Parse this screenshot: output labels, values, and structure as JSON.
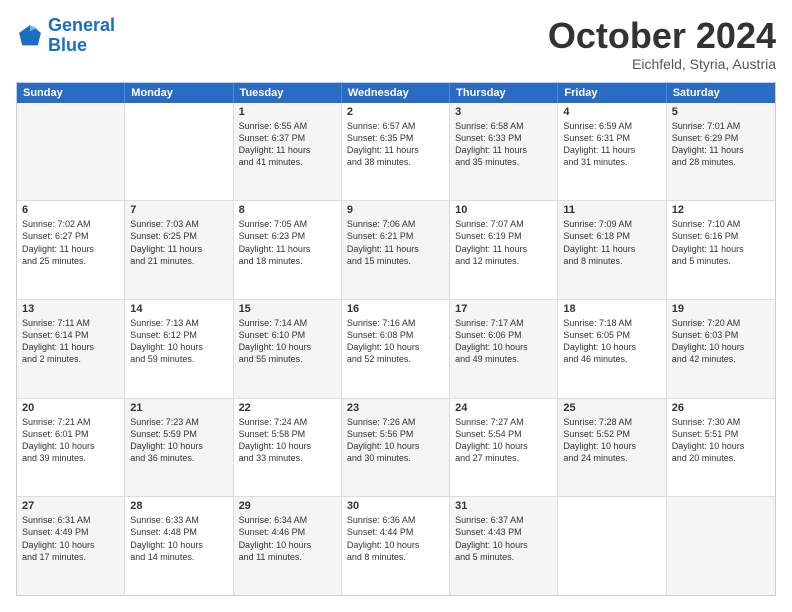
{
  "logo": {
    "line1": "General",
    "line2": "Blue"
  },
  "header": {
    "month": "October 2024",
    "location": "Eichfeld, Styria, Austria"
  },
  "weekdays": [
    "Sunday",
    "Monday",
    "Tuesday",
    "Wednesday",
    "Thursday",
    "Friday",
    "Saturday"
  ],
  "rows": [
    [
      {
        "day": "",
        "lines": [],
        "shaded": true
      },
      {
        "day": "",
        "lines": [],
        "shaded": false
      },
      {
        "day": "1",
        "lines": [
          "Sunrise: 6:55 AM",
          "Sunset: 6:37 PM",
          "Daylight: 11 hours",
          "and 41 minutes."
        ],
        "shaded": true
      },
      {
        "day": "2",
        "lines": [
          "Sunrise: 6:57 AM",
          "Sunset: 6:35 PM",
          "Daylight: 11 hours",
          "and 38 minutes."
        ],
        "shaded": false
      },
      {
        "day": "3",
        "lines": [
          "Sunrise: 6:58 AM",
          "Sunset: 6:33 PM",
          "Daylight: 11 hours",
          "and 35 minutes."
        ],
        "shaded": true
      },
      {
        "day": "4",
        "lines": [
          "Sunrise: 6:59 AM",
          "Sunset: 6:31 PM",
          "Daylight: 11 hours",
          "and 31 minutes."
        ],
        "shaded": false
      },
      {
        "day": "5",
        "lines": [
          "Sunrise: 7:01 AM",
          "Sunset: 6:29 PM",
          "Daylight: 11 hours",
          "and 28 minutes."
        ],
        "shaded": true
      }
    ],
    [
      {
        "day": "6",
        "lines": [
          "Sunrise: 7:02 AM",
          "Sunset: 6:27 PM",
          "Daylight: 11 hours",
          "and 25 minutes."
        ],
        "shaded": false
      },
      {
        "day": "7",
        "lines": [
          "Sunrise: 7:03 AM",
          "Sunset: 6:25 PM",
          "Daylight: 11 hours",
          "and 21 minutes."
        ],
        "shaded": true
      },
      {
        "day": "8",
        "lines": [
          "Sunrise: 7:05 AM",
          "Sunset: 6:23 PM",
          "Daylight: 11 hours",
          "and 18 minutes."
        ],
        "shaded": false
      },
      {
        "day": "9",
        "lines": [
          "Sunrise: 7:06 AM",
          "Sunset: 6:21 PM",
          "Daylight: 11 hours",
          "and 15 minutes."
        ],
        "shaded": true
      },
      {
        "day": "10",
        "lines": [
          "Sunrise: 7:07 AM",
          "Sunset: 6:19 PM",
          "Daylight: 11 hours",
          "and 12 minutes."
        ],
        "shaded": false
      },
      {
        "day": "11",
        "lines": [
          "Sunrise: 7:09 AM",
          "Sunset: 6:18 PM",
          "Daylight: 11 hours",
          "and 8 minutes."
        ],
        "shaded": true
      },
      {
        "day": "12",
        "lines": [
          "Sunrise: 7:10 AM",
          "Sunset: 6:16 PM",
          "Daylight: 11 hours",
          "and 5 minutes."
        ],
        "shaded": false
      }
    ],
    [
      {
        "day": "13",
        "lines": [
          "Sunrise: 7:11 AM",
          "Sunset: 6:14 PM",
          "Daylight: 11 hours",
          "and 2 minutes."
        ],
        "shaded": true
      },
      {
        "day": "14",
        "lines": [
          "Sunrise: 7:13 AM",
          "Sunset: 6:12 PM",
          "Daylight: 10 hours",
          "and 59 minutes."
        ],
        "shaded": false
      },
      {
        "day": "15",
        "lines": [
          "Sunrise: 7:14 AM",
          "Sunset: 6:10 PM",
          "Daylight: 10 hours",
          "and 55 minutes."
        ],
        "shaded": true
      },
      {
        "day": "16",
        "lines": [
          "Sunrise: 7:16 AM",
          "Sunset: 6:08 PM",
          "Daylight: 10 hours",
          "and 52 minutes."
        ],
        "shaded": false
      },
      {
        "day": "17",
        "lines": [
          "Sunrise: 7:17 AM",
          "Sunset: 6:06 PM",
          "Daylight: 10 hours",
          "and 49 minutes."
        ],
        "shaded": true
      },
      {
        "day": "18",
        "lines": [
          "Sunrise: 7:18 AM",
          "Sunset: 6:05 PM",
          "Daylight: 10 hours",
          "and 46 minutes."
        ],
        "shaded": false
      },
      {
        "day": "19",
        "lines": [
          "Sunrise: 7:20 AM",
          "Sunset: 6:03 PM",
          "Daylight: 10 hours",
          "and 42 minutes."
        ],
        "shaded": true
      }
    ],
    [
      {
        "day": "20",
        "lines": [
          "Sunrise: 7:21 AM",
          "Sunset: 6:01 PM",
          "Daylight: 10 hours",
          "and 39 minutes."
        ],
        "shaded": false
      },
      {
        "day": "21",
        "lines": [
          "Sunrise: 7:23 AM",
          "Sunset: 5:59 PM",
          "Daylight: 10 hours",
          "and 36 minutes."
        ],
        "shaded": true
      },
      {
        "day": "22",
        "lines": [
          "Sunrise: 7:24 AM",
          "Sunset: 5:58 PM",
          "Daylight: 10 hours",
          "and 33 minutes."
        ],
        "shaded": false
      },
      {
        "day": "23",
        "lines": [
          "Sunrise: 7:26 AM",
          "Sunset: 5:56 PM",
          "Daylight: 10 hours",
          "and 30 minutes."
        ],
        "shaded": true
      },
      {
        "day": "24",
        "lines": [
          "Sunrise: 7:27 AM",
          "Sunset: 5:54 PM",
          "Daylight: 10 hours",
          "and 27 minutes."
        ],
        "shaded": false
      },
      {
        "day": "25",
        "lines": [
          "Sunrise: 7:28 AM",
          "Sunset: 5:52 PM",
          "Daylight: 10 hours",
          "and 24 minutes."
        ],
        "shaded": true
      },
      {
        "day": "26",
        "lines": [
          "Sunrise: 7:30 AM",
          "Sunset: 5:51 PM",
          "Daylight: 10 hours",
          "and 20 minutes."
        ],
        "shaded": false
      }
    ],
    [
      {
        "day": "27",
        "lines": [
          "Sunrise: 6:31 AM",
          "Sunset: 4:49 PM",
          "Daylight: 10 hours",
          "and 17 minutes."
        ],
        "shaded": true
      },
      {
        "day": "28",
        "lines": [
          "Sunrise: 6:33 AM",
          "Sunset: 4:48 PM",
          "Daylight: 10 hours",
          "and 14 minutes."
        ],
        "shaded": false
      },
      {
        "day": "29",
        "lines": [
          "Sunrise: 6:34 AM",
          "Sunset: 4:46 PM",
          "Daylight: 10 hours",
          "and 11 minutes."
        ],
        "shaded": true
      },
      {
        "day": "30",
        "lines": [
          "Sunrise: 6:36 AM",
          "Sunset: 4:44 PM",
          "Daylight: 10 hours",
          "and 8 minutes."
        ],
        "shaded": false
      },
      {
        "day": "31",
        "lines": [
          "Sunrise: 6:37 AM",
          "Sunset: 4:43 PM",
          "Daylight: 10 hours",
          "and 5 minutes."
        ],
        "shaded": true
      },
      {
        "day": "",
        "lines": [],
        "shaded": false
      },
      {
        "day": "",
        "lines": [],
        "shaded": true
      }
    ]
  ]
}
